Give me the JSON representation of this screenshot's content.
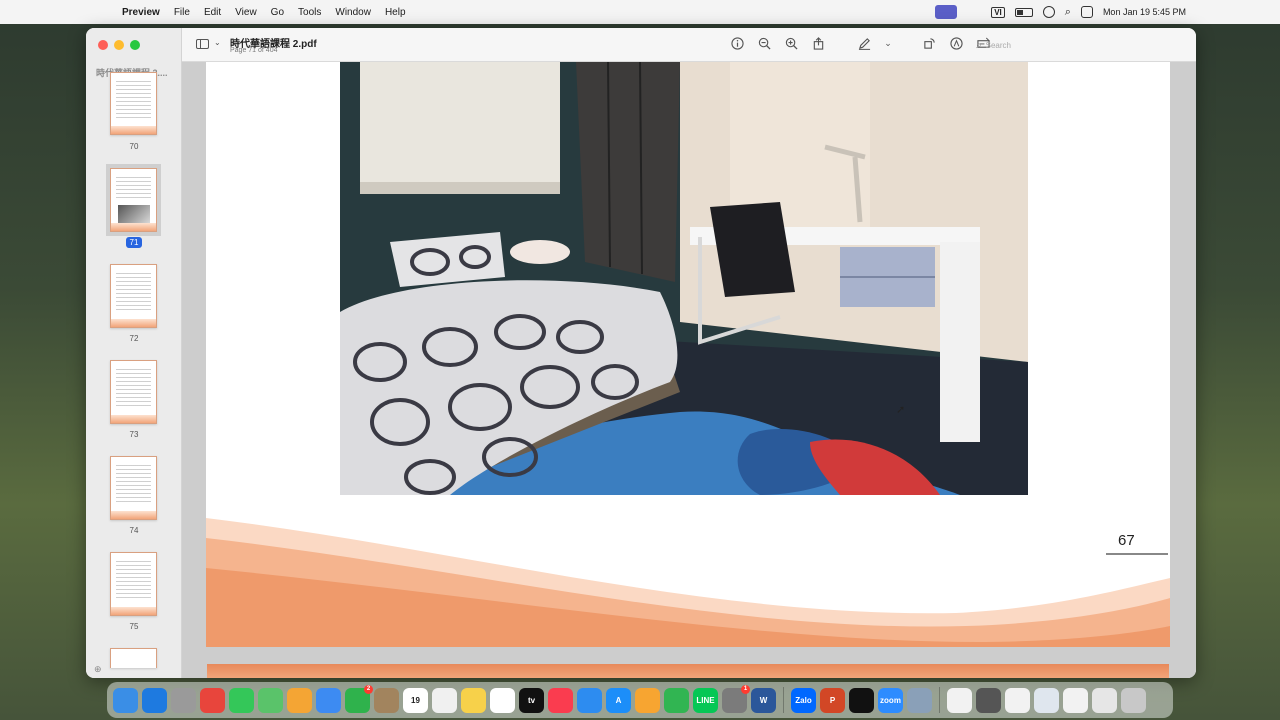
{
  "menubar": {
    "app_name": "Preview",
    "items": [
      "File",
      "Edit",
      "View",
      "Go",
      "Tools",
      "Window",
      "Help"
    ],
    "input_source": "VI",
    "datetime": "Mon Jan 19  5:45 PM"
  },
  "window": {
    "doc_title": "時代華語課程 2.pdf",
    "doc_subtitle": "Page 71 of 404",
    "search_placeholder": "Search"
  },
  "sidebar": {
    "title": "時代華語課程 2....",
    "pages": [
      {
        "label": "70",
        "selected": false,
        "has_photo": false
      },
      {
        "label": "71",
        "selected": true,
        "has_photo": true
      },
      {
        "label": "72",
        "selected": false,
        "has_photo": false
      },
      {
        "label": "73",
        "selected": false,
        "has_photo": false
      },
      {
        "label": "74",
        "selected": false,
        "has_photo": false
      },
      {
        "label": "75",
        "selected": false,
        "has_photo": false
      }
    ]
  },
  "document": {
    "page_number": "67",
    "wave_color": "#f2a57a"
  },
  "dock": {
    "apps": [
      {
        "name": "finder-icon",
        "color": "#3a8ee6",
        "label": ""
      },
      {
        "name": "safari-icon",
        "color": "#1e7ae0",
        "label": ""
      },
      {
        "name": "launchpad-icon",
        "color": "#9a9a9a",
        "label": ""
      },
      {
        "name": "chrome-icon",
        "color": "#e8453c",
        "label": ""
      },
      {
        "name": "messages-icon",
        "color": "#34c759",
        "label": ""
      },
      {
        "name": "maps-icon",
        "color": "#5ac36a",
        "label": ""
      },
      {
        "name": "photos-icon",
        "color": "#f4a534",
        "label": ""
      },
      {
        "name": "mail-icon",
        "color": "#3d8bf2",
        "label": ""
      },
      {
        "name": "facetime-icon",
        "color": "#2fb24c",
        "label": "",
        "badge": "2"
      },
      {
        "name": "app-icon",
        "color": "#a2845e",
        "label": ""
      },
      {
        "name": "calendar-icon",
        "color": "#ffffff",
        "label": "19"
      },
      {
        "name": "reminders-icon",
        "color": "#f0f0f0",
        "label": ""
      },
      {
        "name": "notes-icon",
        "color": "#f7d14a",
        "label": ""
      },
      {
        "name": "freeform-icon",
        "color": "#ffffff",
        "label": ""
      },
      {
        "name": "appletv-icon",
        "color": "#111111",
        "label": "tv"
      },
      {
        "name": "music-icon",
        "color": "#fa3c4f",
        "label": ""
      },
      {
        "name": "keynote-icon",
        "color": "#2d8cf0",
        "label": ""
      },
      {
        "name": "appstore-icon",
        "color": "#1c8ef9",
        "label": "A"
      },
      {
        "name": "pages-icon",
        "color": "#f7a531",
        "label": ""
      },
      {
        "name": "numbers-icon",
        "color": "#31b552",
        "label": ""
      },
      {
        "name": "line-icon",
        "color": "#06c755",
        "label": "LINE"
      },
      {
        "name": "settings-icon",
        "color": "#7b7b7b",
        "label": "",
        "badge": "1"
      },
      {
        "name": "word-icon",
        "color": "#2b579a",
        "label": "W"
      },
      {
        "name": "zalo-icon",
        "color": "#0068ff",
        "label": "Zalo"
      },
      {
        "name": "powerpoint-icon",
        "color": "#d24726",
        "label": "P"
      },
      {
        "name": "capcut-icon",
        "color": "#111111",
        "label": ""
      },
      {
        "name": "zoom-icon",
        "color": "#2d8cff",
        "label": "zoom"
      },
      {
        "name": "preview-icon",
        "color": "#8aa0b8",
        "label": ""
      },
      {
        "name": "document-icon",
        "color": "#f2f2f2",
        "label": ""
      },
      {
        "name": "window-thumb-icon",
        "color": "#555555",
        "label": ""
      },
      {
        "name": "window-thumb-icon-2",
        "color": "#f2f2f2",
        "label": ""
      },
      {
        "name": "window-thumb-icon-3",
        "color": "#dfe6ee",
        "label": ""
      },
      {
        "name": "window-thumb-icon-4",
        "color": "#f2f2f2",
        "label": ""
      },
      {
        "name": "window-thumb-icon-5",
        "color": "#e6e6e6",
        "label": ""
      },
      {
        "name": "trash-icon",
        "color": "#c8c8c8",
        "label": ""
      }
    ]
  }
}
